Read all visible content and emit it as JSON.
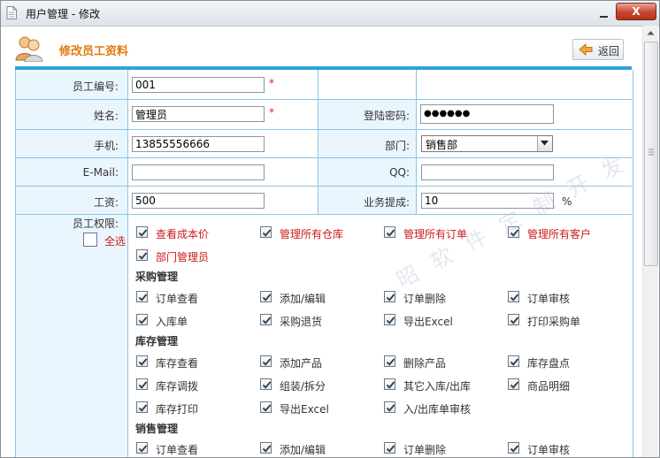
{
  "window": {
    "title": "用户管理 - 修改",
    "close_label": "X"
  },
  "header": {
    "title": "修改员工资料",
    "back_label": "返回"
  },
  "form": {
    "employee_no": {
      "label": "员工编号:",
      "value": "001",
      "required_mark": "*"
    },
    "name": {
      "label": "姓名:",
      "value": "管理员",
      "required_mark": "*"
    },
    "password": {
      "label": "登陆密码:",
      "value": "●●●●●●"
    },
    "phone": {
      "label": "手机:",
      "value": "13855556666"
    },
    "department": {
      "label": "部门:",
      "value": "销售部"
    },
    "email": {
      "label": "E-Mail:",
      "value": ""
    },
    "qq": {
      "label": "QQ:",
      "value": ""
    },
    "salary": {
      "label": "工资:",
      "value": "500"
    },
    "commission": {
      "label": "业务提成:",
      "value": "10",
      "unit": "%"
    },
    "permissions": {
      "label": "员工权限:",
      "select_all": "全选"
    }
  },
  "permissions": {
    "general": [
      "查看成本价",
      "管理所有仓库",
      "管理所有订单",
      "管理所有客户",
      "部门管理员"
    ],
    "purchase": {
      "title": "采购管理",
      "items": [
        "订单查看",
        "添加/编辑",
        "订单删除",
        "订单审核",
        "入库单",
        "采购退货",
        "导出Excel",
        "打印采购单"
      ]
    },
    "inventory": {
      "title": "库存管理",
      "items": [
        "库存查看",
        "添加产品",
        "删除产品",
        "库存盘点",
        "库存调拨",
        "组装/拆分",
        "其它入库/出库",
        "商品明细",
        "库存打印",
        "导出Excel",
        "入/出库单审核"
      ]
    },
    "sales": {
      "title": "销售管理",
      "items": [
        "订单查看",
        "添加/编辑",
        "订单删除",
        "订单审核"
      ]
    }
  },
  "watermark": "昭  软 件 定 制 开 发",
  "colors": {
    "accent_orange": "#e07a10",
    "table_border": "#8cc4e6",
    "label_bg": "#eaf6fd",
    "required": "#e02020",
    "blue_bar": "#2ea3dd"
  }
}
